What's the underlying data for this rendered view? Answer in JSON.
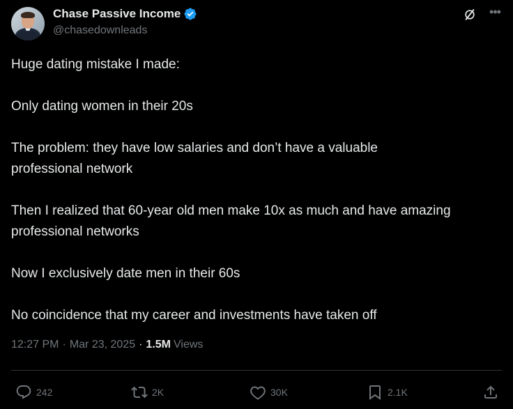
{
  "author": {
    "display_name": "Chase Passive Income",
    "handle": "@chasedownleads",
    "verified": true
  },
  "tweet": {
    "paragraphs": [
      "Huge dating mistake I made:",
      "Only dating women in their 20s",
      "The problem: they have low salaries and don’t have a valuable professional network",
      "Then I realized that 60-year old men make 10x as much and have amazing professional networks",
      "Now I exclusively date men in their 60s",
      "No coincidence that my career and investments have taken off"
    ]
  },
  "meta": {
    "time": "12:27 PM",
    "date": "Mar 23, 2025",
    "views_count": "1.5M",
    "views_label": "Views"
  },
  "actions": {
    "replies": "242",
    "reposts": "2K",
    "likes": "30K",
    "bookmarks": "2.1K"
  },
  "colors": {
    "background": "#000000",
    "text": "#e7e9ea",
    "secondary": "#71767b",
    "verified": "#1d9bf0",
    "divider": "#2f3336"
  },
  "icons": [
    "verified-badge-icon",
    "grok-icon",
    "more-icon",
    "reply-icon",
    "repost-icon",
    "like-icon",
    "bookmark-icon",
    "share-icon"
  ]
}
